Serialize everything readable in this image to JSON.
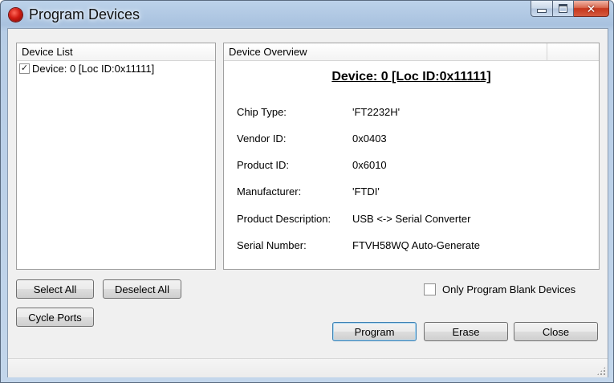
{
  "window": {
    "title": "Program Devices"
  },
  "device_list": {
    "header": "Device List",
    "items": [
      {
        "label": "Device: 0 [Loc ID:0x11111]",
        "checked": true
      }
    ]
  },
  "device_overview": {
    "header": "Device Overview",
    "title": "Device: 0 [Loc ID:0x11111]",
    "fields": [
      {
        "label": "Chip Type:",
        "value": "'FT2232H'"
      },
      {
        "label": "Vendor ID:",
        "value": "0x0403"
      },
      {
        "label": "Product ID:",
        "value": "0x6010"
      },
      {
        "label": "Manufacturer:",
        "value": "'FTDI'"
      },
      {
        "label": "Product Description:",
        "value": "USB <-> Serial Converter"
      },
      {
        "label": "Serial Number:",
        "value": "FTVH58WQ Auto-Generate"
      }
    ]
  },
  "buttons": {
    "select_all": "Select All",
    "deselect_all": "Deselect All",
    "cycle_ports": "Cycle Ports",
    "program": "Program",
    "erase": "Erase",
    "close": "Close"
  },
  "options": {
    "only_program_blank_label": "Only Program Blank Devices",
    "only_program_blank_checked": false
  },
  "colors": {
    "accent": "#3c7fb1",
    "title_bar": "#a9c2df",
    "close_button": "#c6361c"
  }
}
